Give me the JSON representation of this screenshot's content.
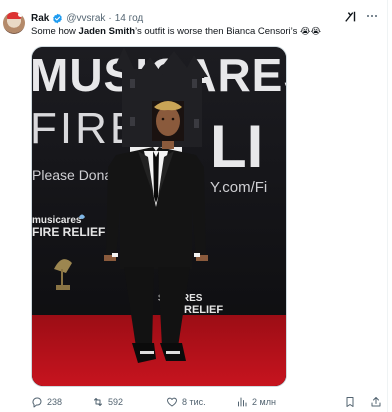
{
  "post": {
    "author_name": "Rak",
    "handle": "@vvsrak",
    "separator": "·",
    "time": "14 год",
    "text_before": "Some how ",
    "text_bold": "Jaden Smith",
    "text_after": "’s outfit is worse then Bianca Censori’s ",
    "text_emoji": "😭😭",
    "grok_label": "x/"
  },
  "media": {
    "backdrop_line1": "MUSICARES",
    "backdrop_line2": "FIRE",
    "backdrop_line2_right": "LI",
    "backdrop_donate": "Please Donat",
    "backdrop_url": "Y.com/Fi",
    "logo_a_line1": "musicares",
    "logo_a_line2": "FIRE RELIEF",
    "logo_b_line1": "SICARES",
    "logo_b_line2": "RELIEF",
    "colors": {
      "backdrop": "#141417",
      "carpet": "#b3101a",
      "suit": "#141414",
      "skin": "#8a5a3c"
    }
  },
  "actions": {
    "replies": "238",
    "reposts": "592",
    "likes": "8 тис.",
    "views": "2 млн"
  },
  "icons": [
    "verified-badge-icon",
    "grok-icon",
    "more-icon",
    "reply-icon",
    "repost-icon",
    "like-icon",
    "views-icon",
    "bookmark-icon",
    "share-icon"
  ]
}
